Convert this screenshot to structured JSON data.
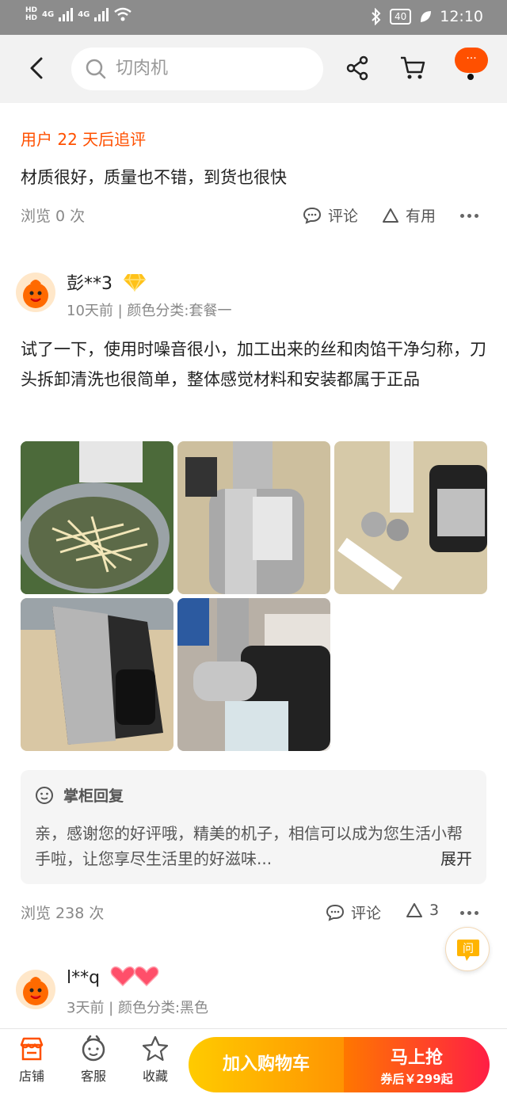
{
  "status_bar": {
    "network_labels": [
      "HD",
      "HD",
      "4G",
      "4G"
    ],
    "battery": "40",
    "time": "12:10"
  },
  "header": {
    "search_text": "切肉机",
    "icons": [
      "back-arrow-icon",
      "search-icon",
      "share-icon",
      "cart-icon",
      "more-icon"
    ],
    "more_bubble": "···"
  },
  "followup": {
    "title": "用户 22 天后追评",
    "text": "材质很好，质量也不错，到货也很快",
    "views": "浏览 0 次",
    "comment_label": "评论",
    "useful_label": "有用"
  },
  "review": {
    "username": "彭**3",
    "meta": "10天前 | 颜色分类:套餐一",
    "text": "试了一下，使用时噪音很小，加工出来的丝和肉馅干净匀称，刀头拆卸清洗也很简单，整体感觉材料和安装都属于正品",
    "photos": [
      "shredded-potato-photo",
      "meat-grinder-side-photo",
      "grinder-parts-photo",
      "grinder-body-photo",
      "grinder-on-counter-photo"
    ],
    "reply_title": "掌柜回复",
    "reply_text": "亲，感谢您的好评哦，精美的机子，相信可以成为您生活小帮手啦，让您享尽生活里的好滋味...",
    "expand_label": "展开",
    "views": "浏览 238 次",
    "comment_label": "评论",
    "like_count": "3"
  },
  "next_review": {
    "username": "l**q",
    "meta": "3天前 | 颜色分类:黑色"
  },
  "ask_button": "问",
  "bottom_bar": {
    "store": "店铺",
    "service": "客服",
    "favorite": "收藏",
    "add_cart": "加入购物车",
    "buy_now": "马上抢",
    "coupon_price": "券后￥299起"
  },
  "colors": {
    "accent": "#ff5000",
    "cart_button": "#ffa800",
    "buy_button": "#ff2a3c"
  }
}
